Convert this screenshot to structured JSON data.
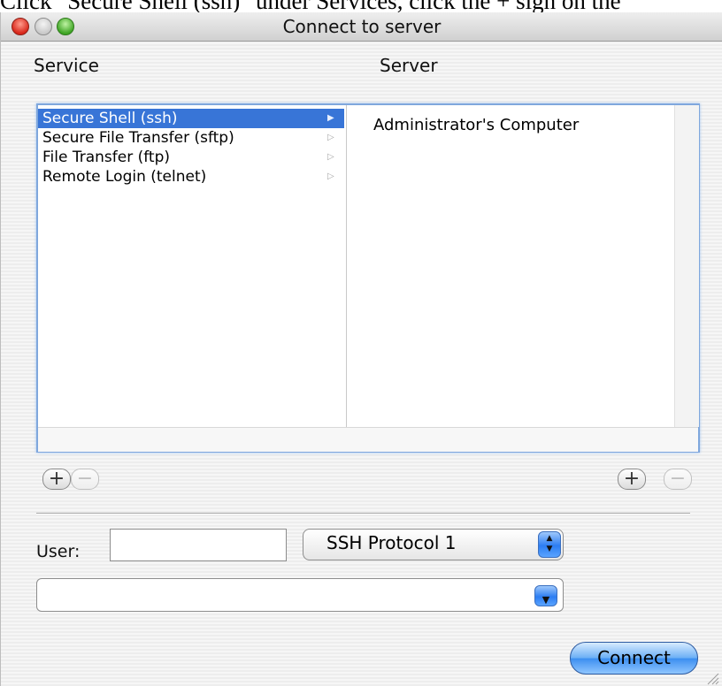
{
  "caption": "Click \"Secure Shell (ssh)\" under Services, click the + sign on the",
  "window": {
    "title": "Connect to server"
  },
  "columns": {
    "service": "Service",
    "server": "Server"
  },
  "services": [
    {
      "label": "Secure Shell (ssh)",
      "selected": true
    },
    {
      "label": "Secure File Transfer (sftp)",
      "selected": false
    },
    {
      "label": "File Transfer (ftp)",
      "selected": false
    },
    {
      "label": "Remote Login (telnet)",
      "selected": false
    }
  ],
  "servers": [
    "Administrator's Computer"
  ],
  "buttons": {
    "add_symbol": "+",
    "remove_symbol": "−",
    "connect": "Connect"
  },
  "user": {
    "label": "User:",
    "value": ""
  },
  "protocol": {
    "selected": "SSH Protocol 1"
  },
  "address": {
    "value": ""
  },
  "colors": {
    "selection": "#3875d7",
    "focus_ring": "#7fa7dd"
  }
}
